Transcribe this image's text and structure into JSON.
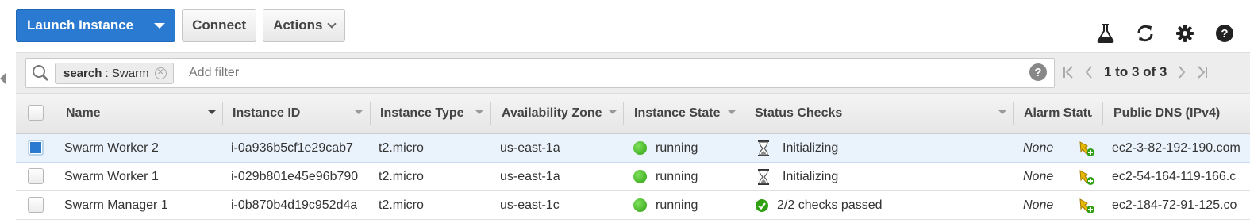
{
  "toolbar": {
    "launch_label": "Launch Instance",
    "connect_label": "Connect",
    "actions_label": "Actions"
  },
  "top_icons": [
    "flask-icon",
    "refresh-icon",
    "gear-icon",
    "help-icon"
  ],
  "filter": {
    "chip_key": "search",
    "chip_sep": " : ",
    "chip_value": "Swarm",
    "placeholder": "Add filter",
    "pagination": "1 to 3 of 3"
  },
  "columns": {
    "name": "Name",
    "instance_id": "Instance ID",
    "instance_type": "Instance Type",
    "availability_zone": "Availability Zone",
    "instance_state": "Instance State",
    "status_checks": "Status Checks",
    "alarm_status": "Alarm Statu",
    "public_dns": "Public DNS (IPv4)"
  },
  "rows": [
    {
      "selected": true,
      "name": "Swarm Worker 2",
      "instance_id": "i-0a936b5cf1e29cab7",
      "instance_type": "t2.micro",
      "az": "us-east-1a",
      "state": "running",
      "status_icon": "hourglass-icon",
      "status": "Initializing",
      "alarm": "None",
      "dns": "ec2-3-82-192-190.com"
    },
    {
      "selected": false,
      "name": "Swarm Worker 1",
      "instance_id": "i-029b801e45e96b790",
      "instance_type": "t2.micro",
      "az": "us-east-1a",
      "state": "running",
      "status_icon": "hourglass-icon",
      "status": "Initializing",
      "alarm": "None",
      "dns": "ec2-54-164-119-166.c"
    },
    {
      "selected": false,
      "name": "Swarm Manager 1",
      "instance_id": "i-0b870b4d19c952d4a",
      "instance_type": "t2.micro",
      "az": "us-east-1c",
      "state": "running",
      "status_icon": "check-circle-icon",
      "status": "2/2 checks passed",
      "alarm": "None",
      "dns": "ec2-184-72-91-125.co"
    }
  ],
  "colors": {
    "primary": "#2a7ad1",
    "running": "#3bb31a",
    "checks_passed": "#2ea012"
  }
}
